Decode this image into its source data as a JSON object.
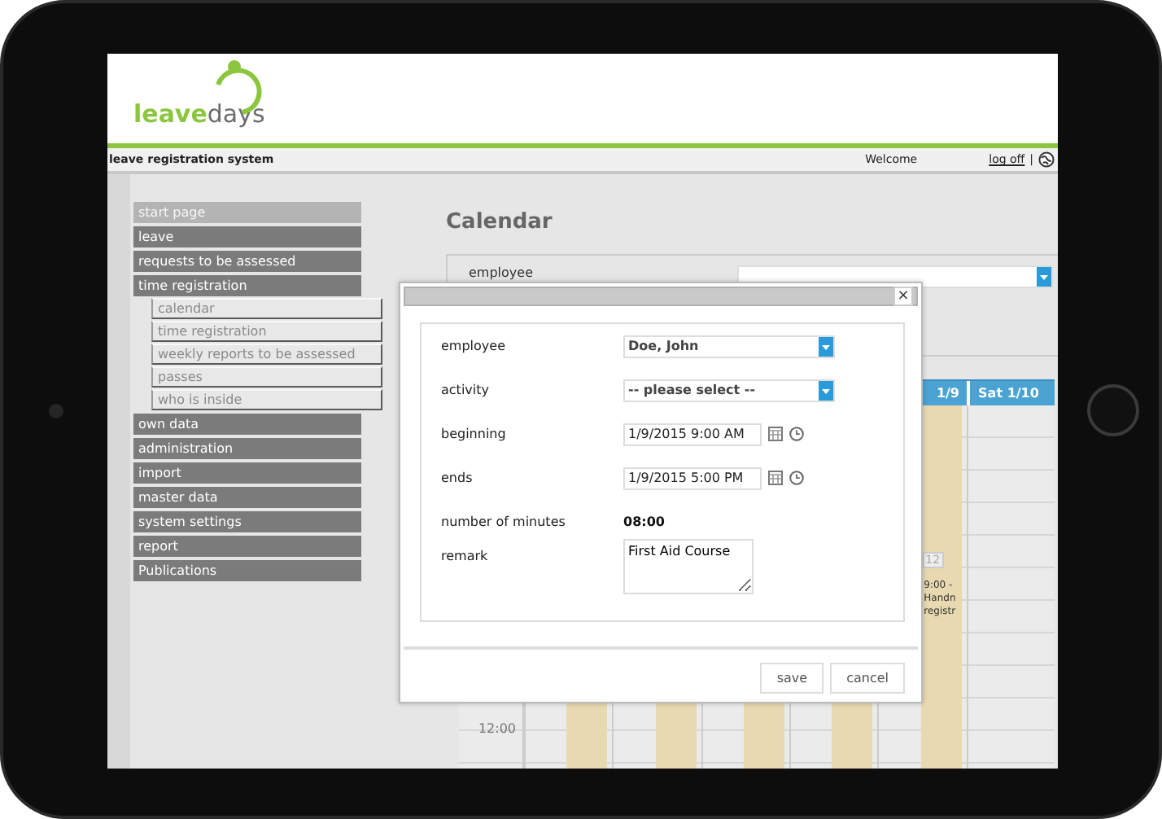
{
  "header": {
    "logo": {
      "part_1": "leave",
      "part_2": "days"
    }
  },
  "top_bar": {
    "title": "leave registration system",
    "welcome": "Welcome",
    "logout": "log off",
    "separator": "|"
  },
  "sidebar": {
    "items": [
      {
        "label": "start page",
        "disabled": true
      },
      {
        "label": "leave",
        "disabled": false
      },
      {
        "label": "requests to be assessed",
        "disabled": false
      },
      {
        "label": "time registration",
        "disabled": false,
        "children": [
          {
            "label": "calendar"
          },
          {
            "label": "time registration"
          },
          {
            "label": "weekly reports to be assessed"
          },
          {
            "label": "passes"
          },
          {
            "label": "who is inside"
          }
        ]
      },
      {
        "label": "own data",
        "disabled": false
      },
      {
        "label": "administration",
        "disabled": false
      },
      {
        "label": "import",
        "disabled": false
      },
      {
        "label": "master data",
        "disabled": false
      },
      {
        "label": "system settings",
        "disabled": false
      },
      {
        "label": "report",
        "disabled": false
      },
      {
        "label": "Publications",
        "disabled": false
      }
    ]
  },
  "page_title": "Calendar",
  "filter": {
    "label": "employee"
  },
  "calendar": {
    "days": [
      {
        "header": "1/9",
        "kind": "workday"
      },
      {
        "header": "Sat 1/10",
        "kind": "weekend"
      }
    ],
    "time_label": "12:00",
    "event": {
      "badge": "12",
      "lines": [
        "9:00 -",
        "Handn",
        "registr"
      ]
    }
  },
  "dialog": {
    "close": "×",
    "fields": [
      {
        "kind": "select",
        "label": "employee",
        "value": "Doe, John"
      },
      {
        "kind": "select",
        "label": "activity",
        "value": "-- please select --"
      },
      {
        "kind": "datetime",
        "label": "beginning",
        "value": "1/9/2015 9:00 AM"
      },
      {
        "kind": "datetime",
        "label": "ends",
        "value": "1/9/2015 5:00 PM"
      },
      {
        "kind": "text",
        "label": "number of minutes",
        "value": "08:00"
      },
      {
        "kind": "textarea",
        "label": "remark",
        "value": "First Aid Course"
      }
    ],
    "buttons": [
      {
        "label": "save"
      },
      {
        "label": "cancel"
      }
    ]
  }
}
